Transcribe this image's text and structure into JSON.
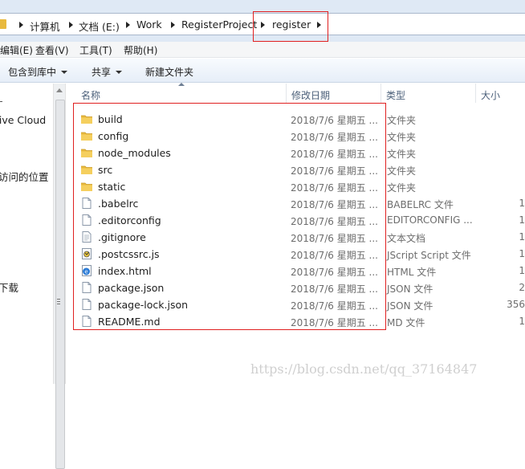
{
  "address_bar": {
    "segments": [
      "计算机",
      "文档 (E:)",
      "Work",
      "RegisterProject",
      "register"
    ]
  },
  "menu_bar": {
    "items": [
      "编辑(E)",
      "查看(V)",
      "工具(T)",
      "帮助(H)"
    ]
  },
  "toolbar": {
    "include_in_library": "包含到库中",
    "share": "共享",
    "new_folder": "新建文件夹"
  },
  "nav_pane": {
    "items": [
      "tive Cloud",
      "访问的位置",
      "下载"
    ]
  },
  "columns": {
    "name": "名称",
    "date": "修改日期",
    "type": "类型",
    "size": "大小"
  },
  "files": [
    {
      "name": "build",
      "date": "2018/7/6 星期五 ...",
      "type": "文件夹",
      "size": "",
      "icon": "folder-icon"
    },
    {
      "name": "config",
      "date": "2018/7/6 星期五 ...",
      "type": "文件夹",
      "size": "",
      "icon": "folder-icon"
    },
    {
      "name": "node_modules",
      "date": "2018/7/6 星期五 ...",
      "type": "文件夹",
      "size": "",
      "icon": "folder-icon"
    },
    {
      "name": "src",
      "date": "2018/7/6 星期五 ...",
      "type": "文件夹",
      "size": "",
      "icon": "folder-icon"
    },
    {
      "name": "static",
      "date": "2018/7/6 星期五 ...",
      "type": "文件夹",
      "size": "",
      "icon": "folder-icon"
    },
    {
      "name": ".babelrc",
      "date": "2018/7/6 星期五 ...",
      "type": "BABELRC 文件",
      "size": "1",
      "icon": "file-icon"
    },
    {
      "name": ".editorconfig",
      "date": "2018/7/6 星期五 ...",
      "type": "EDITORCONFIG ...",
      "size": "1",
      "icon": "file-icon"
    },
    {
      "name": ".gitignore",
      "date": "2018/7/6 星期五 ...",
      "type": "文本文档",
      "size": "1",
      "icon": "text-file-icon"
    },
    {
      "name": ".postcssrc.js",
      "date": "2018/7/6 星期五 ...",
      "type": "JScript Script 文件",
      "size": "1",
      "icon": "script-file-icon"
    },
    {
      "name": "index.html",
      "date": "2018/7/6 星期五 ...",
      "type": "HTML 文件",
      "size": "1",
      "icon": "html-file-icon"
    },
    {
      "name": "package.json",
      "date": "2018/7/6 星期五 ...",
      "type": "JSON 文件",
      "size": "2",
      "icon": "file-icon"
    },
    {
      "name": "package-lock.json",
      "date": "2018/7/6 星期五 ...",
      "type": "JSON 文件",
      "size": "356",
      "icon": "file-icon"
    },
    {
      "name": "README.md",
      "date": "2018/7/6 星期五 ...",
      "type": "MD 文件",
      "size": "1",
      "icon": "file-icon"
    }
  ],
  "watermark": "https://blog.csdn.net/qq_37164847",
  "colors": {
    "highlight_box": "#e02020",
    "folder": "#e8b93e"
  }
}
